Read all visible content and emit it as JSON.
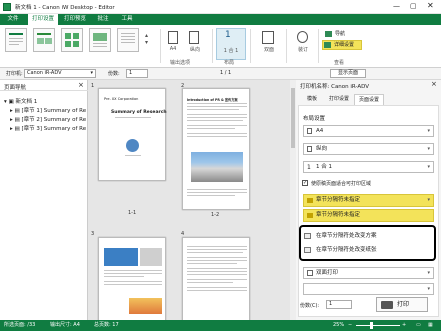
{
  "window": {
    "title": "新文档 1 - Canon iW Desktop - Editor"
  },
  "menu": {
    "tabs": [
      "文件",
      "打印设置",
      "打印预览",
      "批注",
      "工具"
    ],
    "active_index": 1
  },
  "ribbon": {
    "size_label": "A4",
    "orient_label": "纵向",
    "pages_label": "1 合 1",
    "double_label": "双面",
    "duplex_label": "装订",
    "group_layout": "布局",
    "group_output": "输出选项",
    "group_view": "查看",
    "view_btn1": "导航",
    "view_btn2": "详细设置"
  },
  "toolbar2": {
    "printer_label": "打印机:",
    "printer_value": "Canon iR-ADV",
    "copies_label": "份数:",
    "copies_value": "1",
    "pager": "1 / 1",
    "display_label": "显示页面"
  },
  "leftpane": {
    "title": "页面导航",
    "tree": [
      "新文档 1",
      "[章节 1] Summary of Re",
      "[章节 2] Summary of Re",
      "[章节 3] Summary of Re"
    ]
  },
  "pages": [
    {
      "num": "1",
      "label": "1-1",
      "heading": "Summary of Research",
      "company": "Pre. XX Corporation"
    },
    {
      "num": "2",
      "label": "1-2",
      "heading": "Introduction of PR & 宣传方案"
    },
    {
      "num": "3",
      "label": ""
    },
    {
      "num": "4",
      "label": ""
    }
  ],
  "rightpane": {
    "printer": "打印机名称: Canon iR-ADV",
    "tabs": [
      "模板",
      "打印设置",
      "页面设置"
    ],
    "active_tab": 2,
    "section": "布局设置",
    "size": "A4",
    "orient": "纵向",
    "nup": "1 合 1",
    "checkbox": "使原稿页面适合可打印区域",
    "combo1": "章节分隔符未指定",
    "combo2": "章节分隔符未指定",
    "option1": "在章节分隔符处改变方案",
    "option2": "在章节分隔符处改变纸张",
    "duplex": "双面打印",
    "copies_label": "份数(C):",
    "copies_value": "1",
    "print_button": "打印"
  },
  "status": {
    "pages": "所选页面: /33",
    "size": "输出尺寸: A4",
    "count": "总页数: 17",
    "zoom": "25%"
  },
  "colors": {
    "brand": "#107c41",
    "highlight": "#f3e35a"
  }
}
